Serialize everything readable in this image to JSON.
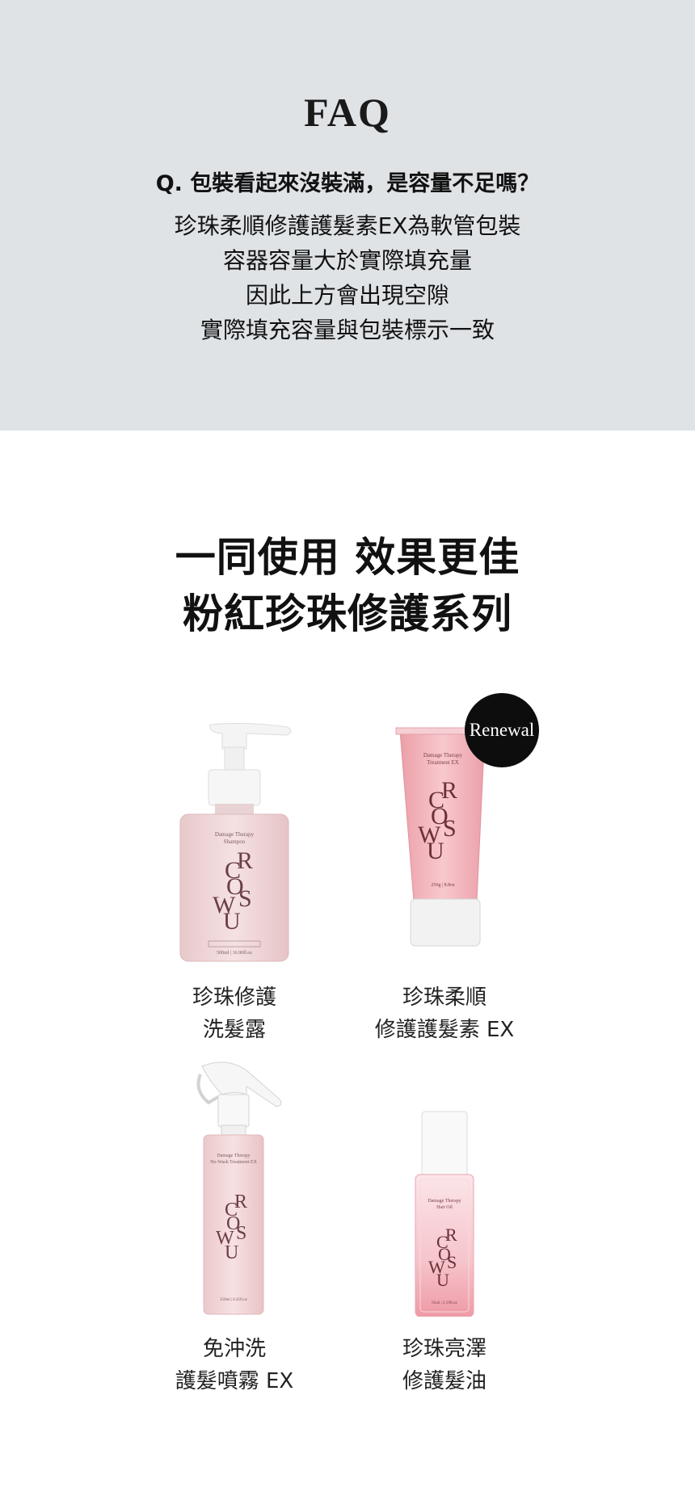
{
  "faq": {
    "title": "FAQ",
    "question": "Q. 包裝看起來沒裝滿，是容量不足嗎？",
    "answer_lines": [
      "珍珠柔順修護護髮素EX為軟管包裝",
      "容器容量大於實際填充量",
      "因此上方會出現空隙",
      "實際填充容量與包裝標示一致"
    ]
  },
  "headline": {
    "lines": [
      "一同使用 效果更佳",
      "粉紅珍珠修護系列"
    ]
  },
  "products": [
    {
      "name_lines": [
        "珍珠修護",
        "洗髮露"
      ],
      "label": [
        "Damage Therapy",
        "Shampoo"
      ],
      "volume": "500ml | 16.90fl.oz",
      "icon": "pump-bottle-icon"
    },
    {
      "name_lines": [
        "珍珠柔順",
        "修護護髮素 EX"
      ],
      "label": [
        "Damage Therapy",
        "Treatment EX"
      ],
      "volume": "250g | 8.8oz",
      "badge": "Renewal",
      "icon": "tube-icon"
    },
    {
      "name_lines": [
        "免沖洗",
        "護髮噴霧 EX"
      ],
      "label": [
        "Damage Therapy",
        "No-Wash Treatment EX"
      ],
      "volume": "250ml | 8.45fl.oz",
      "icon": "spray-bottle-icon"
    },
    {
      "name_lines": [
        "珍珠亮澤",
        "修護髮油"
      ],
      "label": [
        "Damage Therapy",
        "Hair Oil"
      ],
      "volume": "65ml | 2.19fl.oz",
      "icon": "oil-bottle-icon"
    }
  ],
  "brand_mark": "CROWSU",
  "colors": {
    "faq_background": "#dfe3e6",
    "product_pink": "#f1d3d5",
    "badge_black": "#0d0d0d"
  }
}
